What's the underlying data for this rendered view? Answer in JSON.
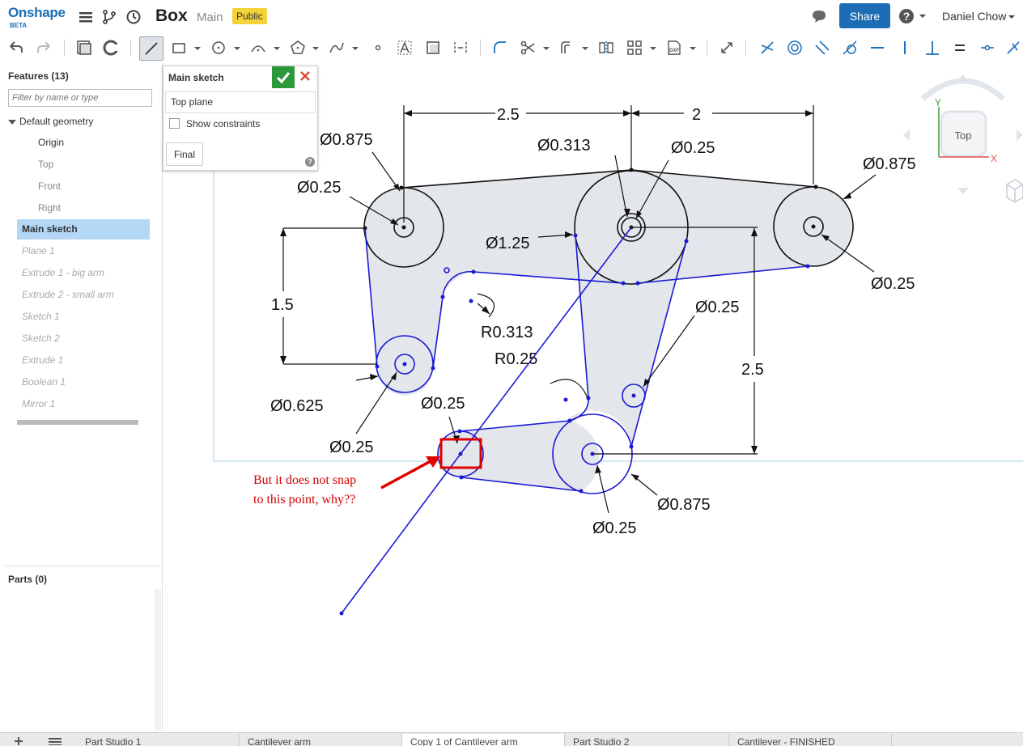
{
  "header": {
    "logo": "Onshape",
    "beta": "BETA",
    "doc_title": "Box",
    "branch": "Main",
    "badge": "Public",
    "share_label": "Share",
    "user": "Daniel Chow"
  },
  "features": {
    "title": "Features (13)",
    "filter_placeholder": "Filter by name or type",
    "default_geometry": "Default geometry",
    "defaults": [
      "Origin",
      "Top",
      "Front",
      "Right"
    ],
    "items": [
      "Main sketch",
      "Plane 1",
      "Extrude 1 - big arm",
      "Extrude 2 - small arm",
      "Sketch 1",
      "Sketch 2",
      "Extrude 1",
      "Boolean 1",
      "Mirror 1"
    ],
    "selected": "Main sketch"
  },
  "parts": {
    "title": "Parts (0)"
  },
  "sketch_dialog": {
    "title": "Main sketch",
    "plane": "Top plane",
    "show_constraints": "Show constraints",
    "final_label": "Final"
  },
  "view_cube": {
    "face": "Top",
    "x_axis": "X",
    "y_axis": "Y"
  },
  "dimensions": {
    "d_left_top": "Ø0.875",
    "d_left_inner": "Ø0.25",
    "h_left": "2.5",
    "h_right": "2",
    "d_center_small": "Ø0.313",
    "d_center_inner": "Ø0.25",
    "d_right_outer": "Ø0.875",
    "d_right_inner": "Ø0.25",
    "d_center_big": "Ø1.25",
    "v_left": "1.5",
    "r_upper": "R0.313",
    "r_lower": "R0.25",
    "d_small_hole": "Ø0.25",
    "v_right": "2.5",
    "d_left_mid_outer": "Ø0.625",
    "d_left_mid_inner": "Ø0.25",
    "d_snap_target": "Ø0.25",
    "d_bottom_outer": "Ø0.875",
    "d_bottom_inner": "Ø0.25"
  },
  "annotation": {
    "line1": "But it does not snap",
    "line2": "to this point, why??"
  },
  "tabs": [
    "Part Studio 1",
    "Cantilever arm",
    "Copy 1 of Cantilever arm",
    "Part Studio 2",
    "Cantilever - FINISHED"
  ],
  "active_tab": "Copy 1 of Cantilever arm",
  "colors": {
    "brand": "#1a6fb8",
    "share": "#1d6db6",
    "badge": "#f4d23a",
    "sketch_blue": "#1a1ad6",
    "annotation_red": "#d40000",
    "region_fill": "#e3e6ea",
    "ok_green": "#2c9a3b"
  }
}
